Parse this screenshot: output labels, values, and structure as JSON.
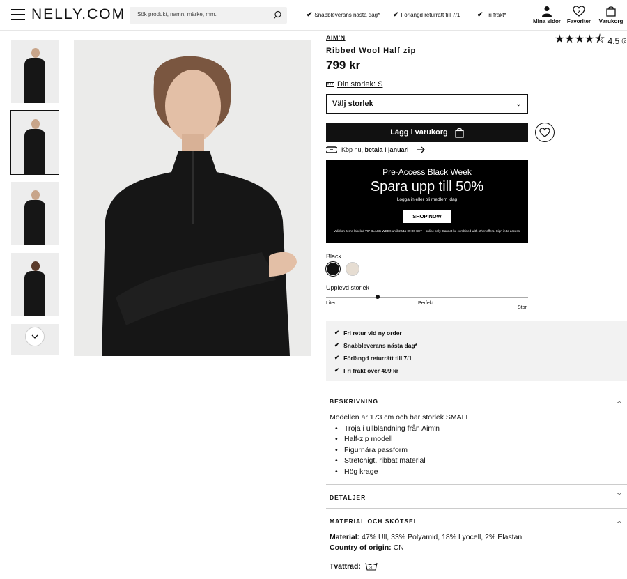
{
  "header": {
    "logo": "NELLY.COM",
    "search_placeholder": "Sök produkt, namn, märke, mm.",
    "usps": [
      "Snabbleverans nästa dag*",
      "Förlängd returrätt till 7/1",
      "Fri frakt*"
    ],
    "account": "Mina sidor",
    "favorites": "Favoriter",
    "favorites_count": "2",
    "cart": "Varukorg"
  },
  "product": {
    "brand": "AIM'N",
    "name": "Ribbed Wool Half zip",
    "price": "799 kr",
    "rating_value": "4.5",
    "rating_count": "(2",
    "rating_stars": 4.5,
    "my_size": "Din storlek: S",
    "size_select": "Välj storlek",
    "add_to_cart": "Lägg i varukorg",
    "klarna_prefix": "Köp nu,",
    "klarna_bold": "betala i januari",
    "color_label": "Black",
    "colors": [
      "#111111",
      "#e6ddd2"
    ]
  },
  "promo": {
    "line1": "Pre-Access Black Week",
    "line2": "Spara upp till 50%",
    "line3": "Logga in eller bli medlem idag",
    "button": "SHOP NOW",
    "fine": "Valid on items labeled VIP BLACK WEEK until 22/11 09:00 CET – online only. Cannot be combined with other offers. Sign in to access."
  },
  "fit": {
    "label": "Upplevd storlek",
    "low": "Liten",
    "mid": "Perfekt",
    "high": "Stor",
    "level": 0.25
  },
  "usp_box": [
    "Fri retur vid ny order",
    "Snabbleverans nästa dag*",
    "Förlängd returrätt till 7/1",
    "Fri frakt över 499 kr"
  ],
  "sections": {
    "description_title": "BESKRIVNING",
    "description_intro": "Modellen är 173 cm och bär storlek SMALL",
    "description_items": [
      "Tröja i ullblandning från Aim'n",
      "Half-zip modell",
      "Figurnära passform",
      "Stretchigt, ribbat material",
      "Hög krage"
    ],
    "details_title": "DETALJER",
    "material_title": "MATERIAL OCH SKÖTSEL",
    "material_label": "Material:",
    "material_value": "47% Ull, 33% Polyamid, 18% Lyocell, 2% Elastan",
    "origin_label": "Country of origin:",
    "origin_value": "CN",
    "wash_label": "Tvätträd:"
  }
}
